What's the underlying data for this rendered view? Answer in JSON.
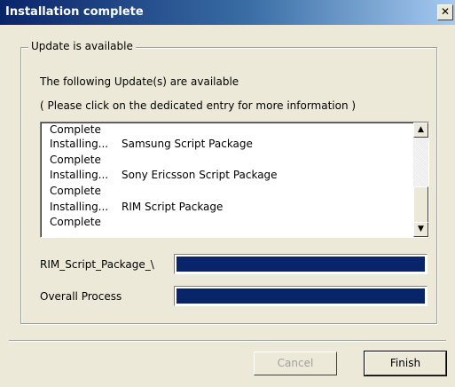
{
  "window": {
    "title": "Installation complete",
    "close_glyph": "✕"
  },
  "group": {
    "legend": "Update is available"
  },
  "text": {
    "line1": "The following Update(s) are available",
    "line2": "( Please click on the dedicated entry for more information )"
  },
  "log": [
    {
      "col1": "Complete",
      "col2": ""
    },
    {
      "col1": "Installing...",
      "col2": "Samsung Script Package"
    },
    {
      "col1": "Complete",
      "col2": ""
    },
    {
      "col1": "Installing...",
      "col2": "Sony Ericsson Script Package"
    },
    {
      "col1": "Complete",
      "col2": ""
    },
    {
      "col1": "Installing...",
      "col2": "RIM Script Package"
    },
    {
      "col1": "Complete",
      "col2": ""
    }
  ],
  "progress": [
    {
      "label": "RIM_Script_Package_\\",
      "value": 100
    },
    {
      "label": "Overall Process",
      "value": 100
    }
  ],
  "buttons": {
    "cancel": "Cancel",
    "finish": "Finish"
  },
  "colors": {
    "progress_fill": "#0a246a",
    "window_bg": "#ece9d8"
  }
}
